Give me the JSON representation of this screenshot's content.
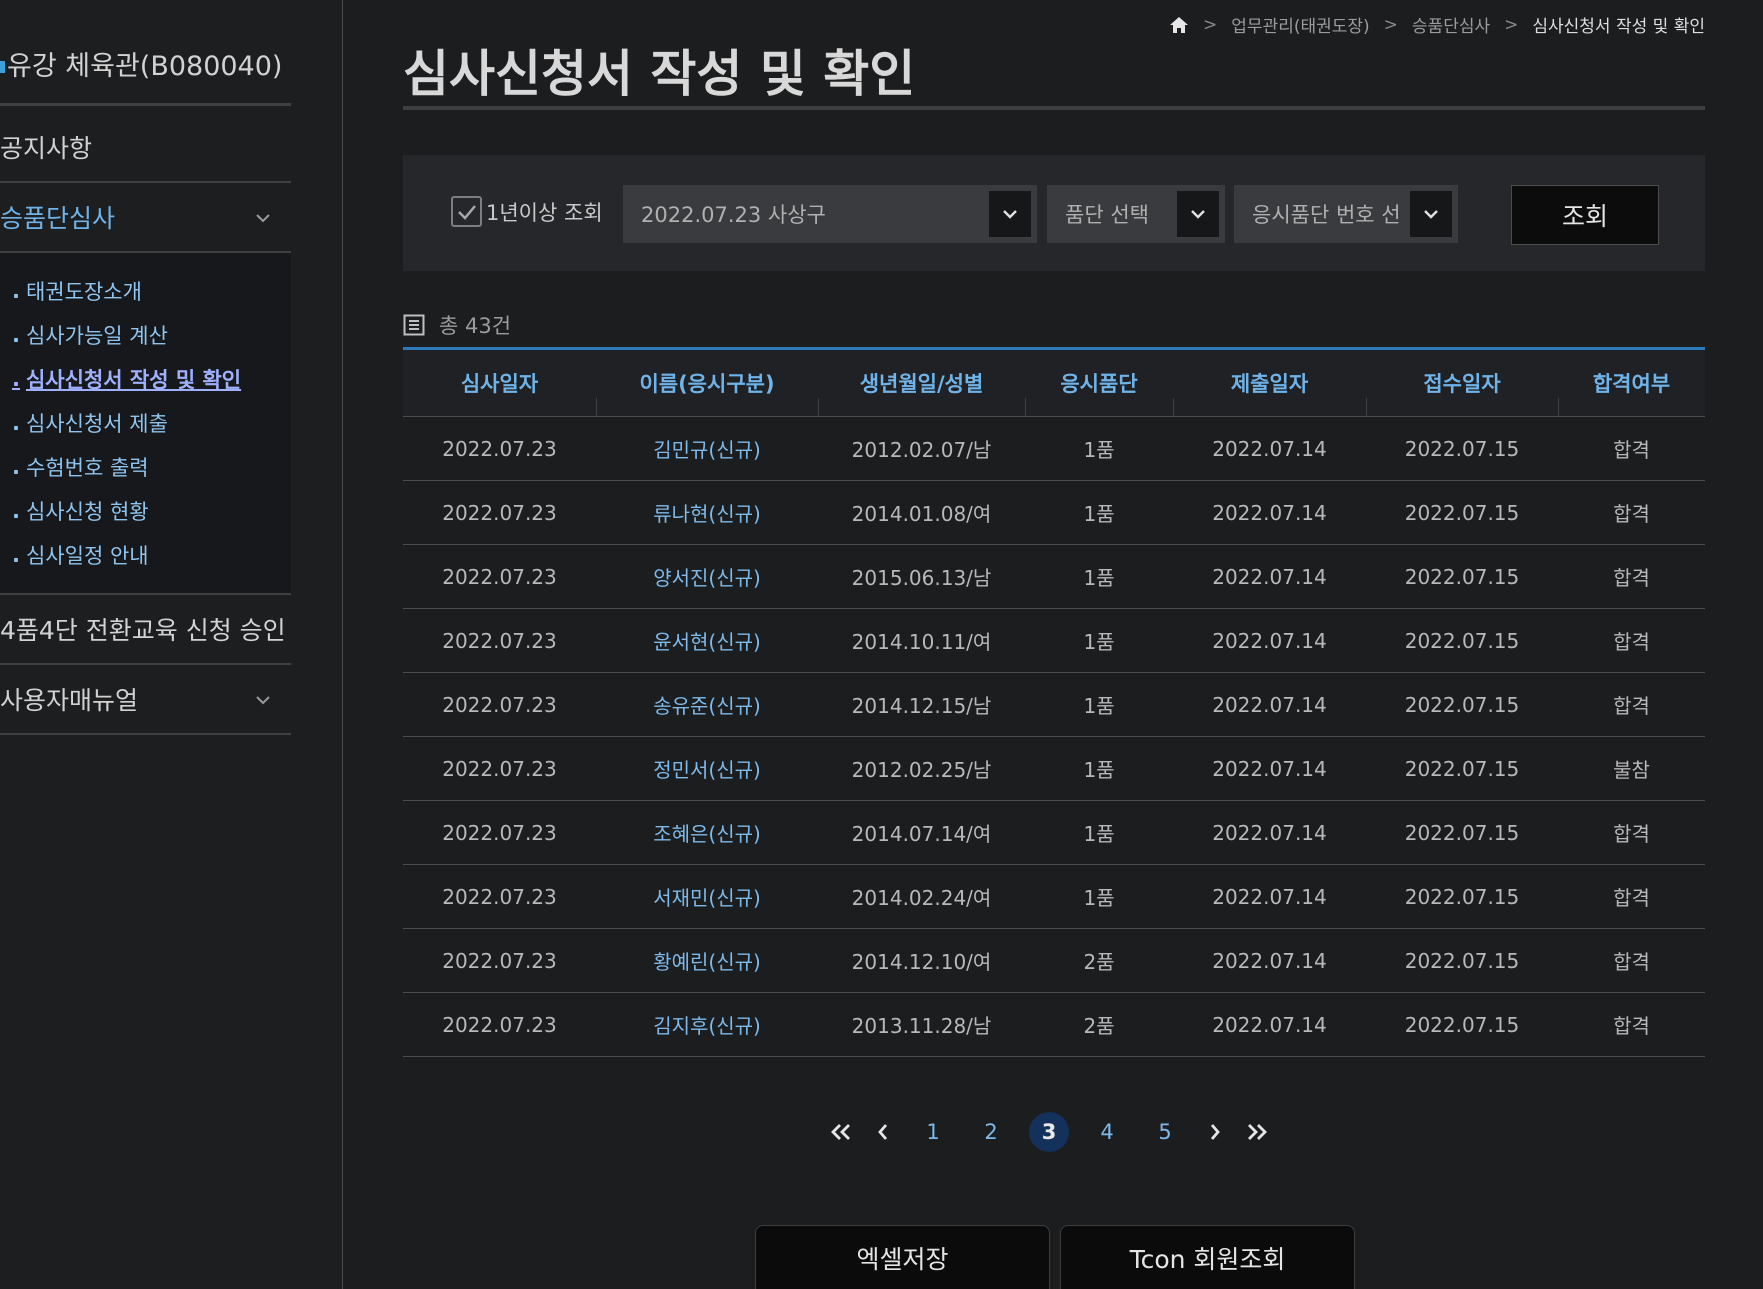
{
  "sidebar": {
    "org_name": "유강 체육관(B080040)",
    "menu": [
      {
        "label": "공지사항"
      },
      {
        "label": "승품단심사",
        "expanded": true
      },
      {
        "label": "4품4단 전환교육 신청 승인"
      },
      {
        "label": "사용자매뉴얼"
      }
    ],
    "submenu": [
      {
        "bullet": ".",
        "label": "태권도장소개"
      },
      {
        "bullet": ".",
        "label": "심사가능일 계산"
      },
      {
        "bullet": ".",
        "label": "심사신청서 작성 및 확인"
      },
      {
        "bullet": ".",
        "label": "심사신청서 제출"
      },
      {
        "bullet": ".",
        "label": "수험번호 출력"
      },
      {
        "bullet": ".",
        "label": "심사신청 현황"
      },
      {
        "bullet": ".",
        "label": "심사일정 안내"
      }
    ]
  },
  "breadcrumb": {
    "sep": ">",
    "items": [
      "업무관리(태권도장)",
      "승품단심사",
      "심사신청서 작성 및 확인"
    ]
  },
  "page_title": "심사신청서 작성 및 확인",
  "search": {
    "checkbox_label": "1년이상 조회",
    "checkbox_checked": true,
    "exam_select": "2022.07.23 사상구",
    "rank_select": "품단 선택",
    "number_select": "응시품단 번호 선",
    "search_button": "조회"
  },
  "count_text": "총 43건",
  "table": {
    "headers": [
      "심사일자",
      "이름(응시구분)",
      "생년월일/성별",
      "응시품단",
      "제출일자",
      "접수일자",
      "합격여부"
    ],
    "rows": [
      [
        "2022.07.23",
        "김민규(신규)",
        "2012.02.07/남",
        "1품",
        "2022.07.14",
        "2022.07.15",
        "합격"
      ],
      [
        "2022.07.23",
        "류나현(신규)",
        "2014.01.08/여",
        "1품",
        "2022.07.14",
        "2022.07.15",
        "합격"
      ],
      [
        "2022.07.23",
        "양서진(신규)",
        "2015.06.13/남",
        "1품",
        "2022.07.14",
        "2022.07.15",
        "합격"
      ],
      [
        "2022.07.23",
        "윤서현(신규)",
        "2014.10.11/여",
        "1품",
        "2022.07.14",
        "2022.07.15",
        "합격"
      ],
      [
        "2022.07.23",
        "송유준(신규)",
        "2014.12.15/남",
        "1품",
        "2022.07.14",
        "2022.07.15",
        "합격"
      ],
      [
        "2022.07.23",
        "정민서(신규)",
        "2012.02.25/남",
        "1품",
        "2022.07.14",
        "2022.07.15",
        "불참"
      ],
      [
        "2022.07.23",
        "조혜은(신규)",
        "2014.07.14/여",
        "1품",
        "2022.07.14",
        "2022.07.15",
        "합격"
      ],
      [
        "2022.07.23",
        "서재민(신규)",
        "2014.02.24/여",
        "1품",
        "2022.07.14",
        "2022.07.15",
        "합격"
      ],
      [
        "2022.07.23",
        "황예린(신규)",
        "2014.12.10/여",
        "2품",
        "2022.07.14",
        "2022.07.15",
        "합격"
      ],
      [
        "2022.07.23",
        "김지후(신규)",
        "2013.11.28/남",
        "2품",
        "2022.07.14",
        "2022.07.15",
        "합격"
      ]
    ]
  },
  "pagination": {
    "first": "«",
    "prev": "‹",
    "pages": [
      "1",
      "2",
      "3",
      "4",
      "5"
    ],
    "current": "3",
    "next": "›",
    "last": "»"
  },
  "buttons": {
    "excel": "엑셀저장",
    "tcon": "Tcon 회원조회"
  },
  "colors": {
    "accent": "#6fb3e8",
    "link": "#7db9ea",
    "active_page": "#13315a",
    "table_rule": "#2b79b8"
  },
  "icons": {
    "home": "home-icon",
    "list": "list-icon",
    "check": "check-icon",
    "chevron": "chevron-down-icon"
  }
}
